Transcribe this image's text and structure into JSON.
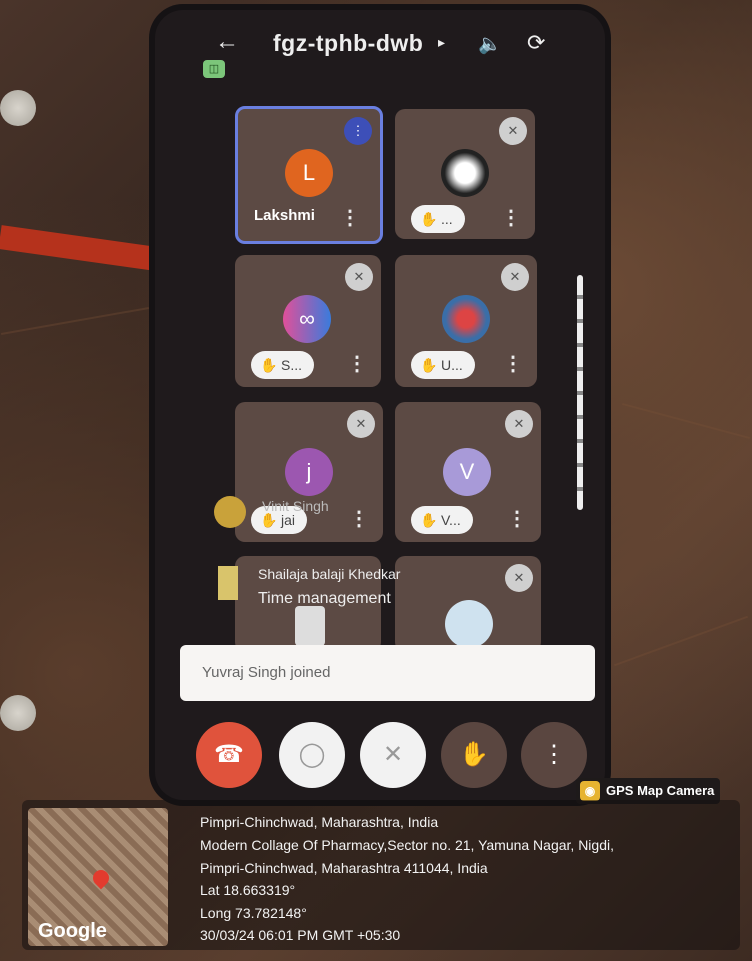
{
  "header": {
    "back_icon": "arrow-left-icon",
    "meet_code": "fgz-tphb-dwb",
    "speaker_icon": "speaker-icon",
    "camera_switch_icon": "camera-switch-icon"
  },
  "tiles": [
    {
      "name": "Lakshmi",
      "avatar_letter": "L",
      "avatar_color": "#e0651f",
      "speaking": true
    },
    {
      "avatar_image": "profile-photo",
      "hand_label": "...",
      "muted": true
    },
    {
      "avatar_image": "infinity-logo",
      "hand_label": "S...",
      "muted": true
    },
    {
      "avatar_image": "profile-photo",
      "hand_label": "U...",
      "muted": true
    },
    {
      "avatar_letter": "j",
      "avatar_color": "#9c57b0",
      "hand_label": "jai",
      "muted": true
    },
    {
      "avatar_letter": "V",
      "avatar_color": "#a89ad8",
      "hand_label": "V...",
      "muted": true
    },
    {
      "avatar_image": "profile-photo",
      "muted": true
    },
    {
      "avatar_image": "doctor-photo",
      "muted": true
    }
  ],
  "overlay_name": "Vinit Singh",
  "chat": {
    "sender": "Shailaja balaji Khedkar",
    "message": "Time management"
  },
  "toast": "Yuvraj Singh joined",
  "controls": [
    {
      "name": "end-call",
      "icon": "phone-hangup-icon",
      "color": "#e0533c"
    },
    {
      "name": "camera-off",
      "icon": "camera-off-icon",
      "color": "#f2f2f2"
    },
    {
      "name": "mic-off",
      "icon": "mic-off-icon",
      "color": "#f2f2f2"
    },
    {
      "name": "raise-hand",
      "icon": "hand-icon",
      "color": "#5a4640"
    },
    {
      "name": "more-options",
      "icon": "more-vert-icon",
      "color": "#5a4640"
    }
  ],
  "geo": {
    "badge": "GPS Map Camera",
    "city": "Pimpri-Chinchwad, Maharashtra, India",
    "address1": "Modern Collage Of Pharmacy,Sector no. 21, Yamuna Nagar, Nigdi,",
    "address2": "Pimpri-Chinchwad, Maharashtra 411044, India",
    "lat": "Lat 18.663319°",
    "long": "Long 73.782148°",
    "timestamp": "30/03/24 06:01 PM GMT +05:30",
    "map_brand": "Google"
  }
}
